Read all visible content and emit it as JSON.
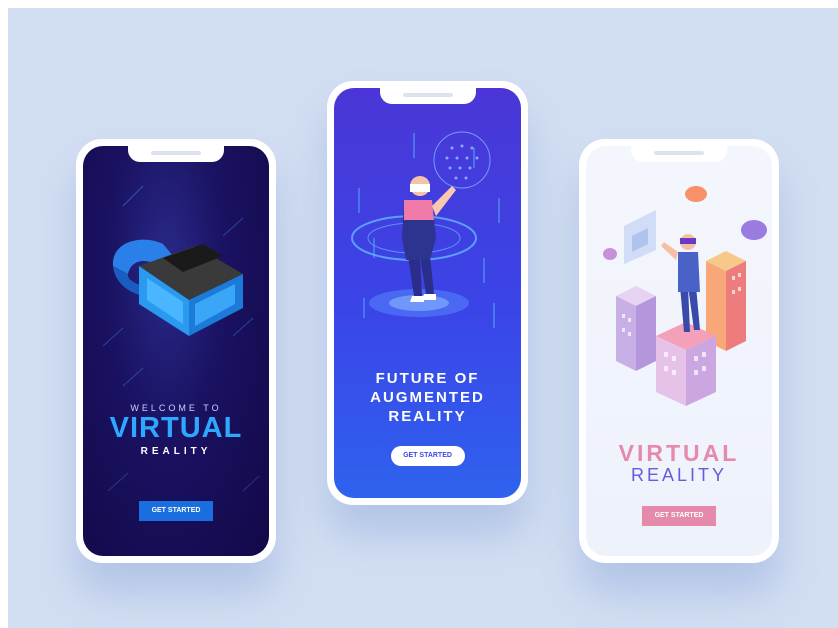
{
  "colors": {
    "background": "#d2def2",
    "phone1_bg": "#140a4a",
    "phone2_bg": "#3a45e6",
    "phone3_bg": "#f0f4fc",
    "accent_blue": "#2aa3ff",
    "accent_pink": "#e28aa8",
    "accent_purple": "#6a5ad6"
  },
  "phones": [
    {
      "welcome": "WELCOME TO",
      "title": "VIRTUAL",
      "subtitle": "REALITY",
      "button": "GET STARTED",
      "illustration": "vr-headset-icon"
    },
    {
      "title_lines": [
        "FUTURE OF",
        "AUGMENTED",
        "REALITY"
      ],
      "button": "GET STARTED",
      "illustration": "person-with-hologram-icon"
    },
    {
      "title": "VIRTUAL",
      "subtitle": "REALITY",
      "button": "GET STARTED",
      "illustration": "person-on-buildings-icon"
    }
  ]
}
